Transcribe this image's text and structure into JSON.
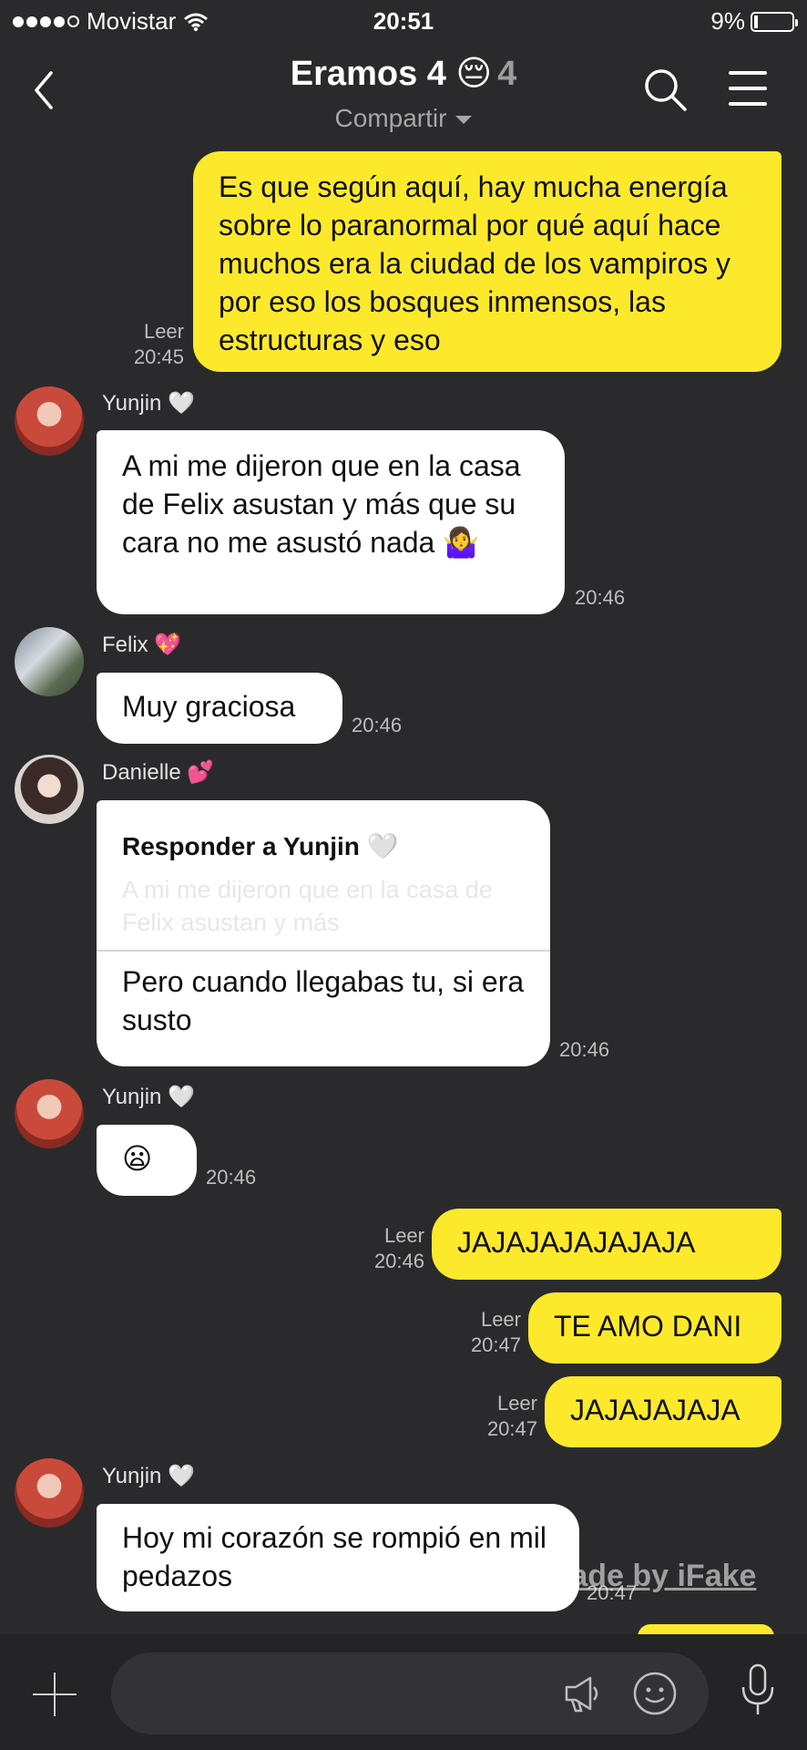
{
  "status": {
    "carrier": "Movistar",
    "time": "20:51",
    "battery": "9%"
  },
  "header": {
    "title": "Eramos 4 😔",
    "member_count": "4",
    "subtitle": "Compartir"
  },
  "messages": {
    "m1": {
      "text": "Es que según aquí, hay mucha energía sobre lo paranormal por qué aquí hace muchos era la ciudad de los vampiros y por eso los bosques inmensos, las estructuras y eso",
      "read": "Leer",
      "time": "20:45"
    },
    "m2": {
      "sender": "Yunjin 🤍",
      "text": "A mi me dijeron que en la casa de Felix asustan y más que su cara no me asustó nada 🤷‍♀️",
      "time": "20:46"
    },
    "m3": {
      "sender": "Felix 💖",
      "text": "Muy graciosa",
      "time": "20:46"
    },
    "m4": {
      "sender": "Danielle 💕",
      "reply_label": "Responder a Yunjin 🤍",
      "reply_quote": "A mi me dijeron que en la casa de Felix asustan y más",
      "text": "Pero cuando llegabas tu, si era susto",
      "time": "20:46"
    },
    "m5": {
      "sender": "Yunjin 🤍",
      "text": "😦",
      "time": "20:46"
    },
    "m6": {
      "text": "JAJAJAJAJAJAJA",
      "read": "Leer",
      "time": "20:46"
    },
    "m7": {
      "text": "TE AMO DANI",
      "read": "Leer",
      "time": "20:47"
    },
    "m8": {
      "text": "JAJAJAJAJA",
      "read": "Leer",
      "time": "20:47"
    },
    "m9": {
      "sender": "Yunjin 🤍",
      "text": "Hoy mi corazón se rompió en mil pedazos",
      "time": "20:47"
    }
  },
  "watermark": "Made by iFake",
  "icons": {
    "back": "chevron-left-icon",
    "search": "search-icon",
    "menu": "menu-icon",
    "add": "plus-icon",
    "shout": "megaphone-icon",
    "emoji": "emoji-icon",
    "mic": "microphone-icon"
  }
}
